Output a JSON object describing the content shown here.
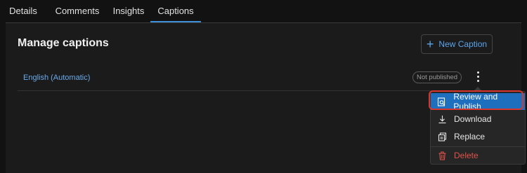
{
  "tabs": [
    {
      "label": "Details"
    },
    {
      "label": "Comments"
    },
    {
      "label": "Insights"
    },
    {
      "label": "Captions"
    }
  ],
  "active_tab": "Captions",
  "panel": {
    "title": "Manage captions",
    "new_button_label": "New Caption"
  },
  "captions": [
    {
      "language": "English (Automatic)",
      "status": "Not published"
    }
  ],
  "menu": {
    "items": [
      {
        "label": "Review and Publish",
        "icon": "review-icon"
      },
      {
        "label": "Download",
        "icon": "download-icon"
      },
      {
        "label": "Replace",
        "icon": "replace-icon"
      },
      {
        "label": "Delete",
        "icon": "trash-icon"
      }
    ]
  },
  "colors": {
    "accent": "#3f8fd8",
    "link": "#6aabeb",
    "danger": "#e0524a",
    "highlight": "#1f6fbf",
    "annotation_ring": "#d9372d"
  }
}
